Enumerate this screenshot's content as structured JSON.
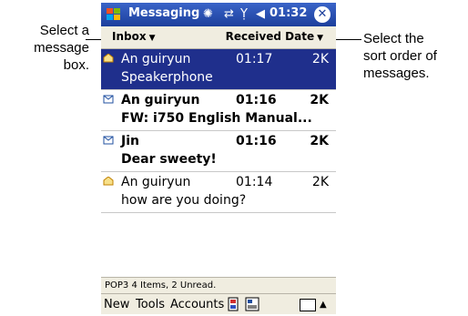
{
  "callouts": {
    "left": [
      "Select a",
      "message",
      "box."
    ],
    "right": [
      "Select the",
      "sort order of",
      "messages."
    ]
  },
  "titlebar": {
    "app_title": "Messaging",
    "clock": "01:32",
    "close_label": "✕"
  },
  "toolbar": {
    "folder": "Inbox",
    "sort": "Received Date"
  },
  "messages": [
    {
      "from": "An guiryun",
      "time": "01:17",
      "size": "2K",
      "subject": "Speakerphone",
      "selected": true,
      "unread": false
    },
    {
      "from": "An guiryun",
      "time": "01:16",
      "size": "2K",
      "subject": "FW: i750 English Manual...",
      "selected": false,
      "unread": true
    },
    {
      "from": "Jin",
      "time": "01:16",
      "size": "2K",
      "subject": "Dear sweety!",
      "selected": false,
      "unread": true
    },
    {
      "from": "An guiryun",
      "time": "01:14",
      "size": "2K",
      "subject": "how are you doing?",
      "selected": false,
      "unread": false
    }
  ],
  "status": "POP3  4 Items, 2 Unread.",
  "menubar": {
    "new": "New",
    "tools": "Tools",
    "accounts": "Accounts",
    "sip_arrow": "▲"
  },
  "colors": {
    "selection": "#1f2f8c",
    "titlebar": "#1c3f9c",
    "bar_background": "#f0ede0"
  }
}
